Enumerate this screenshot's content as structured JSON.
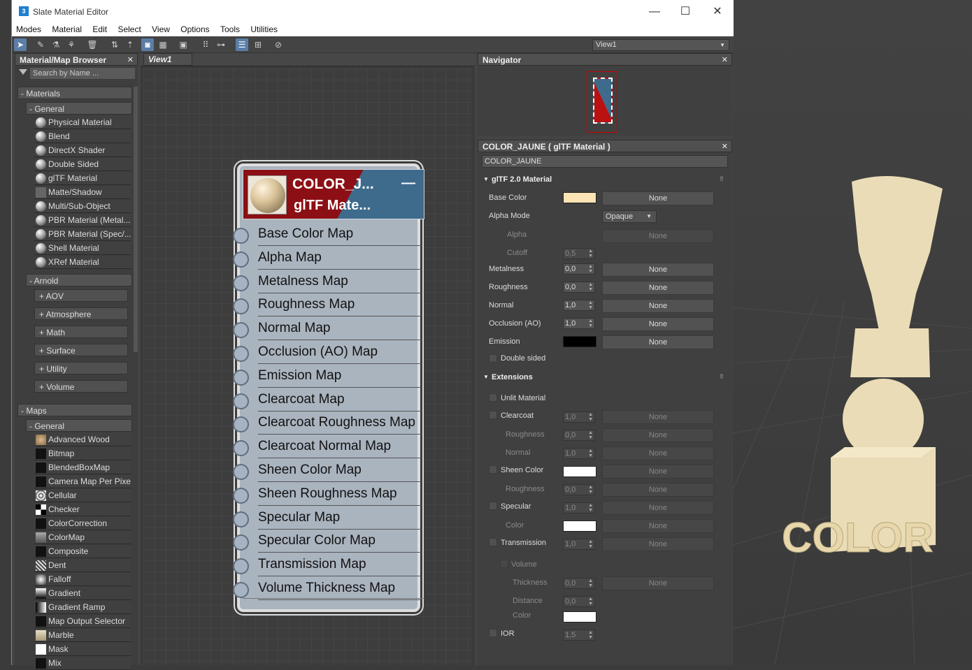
{
  "window": {
    "title": "Slate Material Editor",
    "app_icon": "3",
    "min": "—",
    "max": "☐",
    "close": "✕"
  },
  "menu": [
    "Modes",
    "Material",
    "Edit",
    "Select",
    "View",
    "Options",
    "Tools",
    "Utilities"
  ],
  "toolbar": {
    "view_select": "View1"
  },
  "browser": {
    "title": "Material/Map Browser",
    "search_placeholder": "Search by Name ...",
    "materials_label": "- Materials",
    "general_label": "- General",
    "materials": [
      "Physical Material",
      "Blend",
      "DirectX Shader",
      "Double Sided",
      "glTF Material",
      "Matte/Shadow",
      "Multi/Sub-Object",
      "PBR Material (Metal...",
      "PBR Material (Spec/...",
      "Shell Material",
      "XRef Material"
    ],
    "arnold_label": "- Arnold",
    "arnold": [
      "+ AOV",
      "+ Atmosphere",
      "+ Math",
      "+ Surface",
      "+ Utility",
      "+ Volume"
    ],
    "maps_label": "- Maps",
    "maps_general_label": "- General",
    "maps": [
      "Advanced Wood",
      "Bitmap",
      "BlendedBoxMap",
      "Camera Map Per Pixel",
      "Cellular",
      "Checker",
      "ColorCorrection",
      "ColorMap",
      "Composite",
      "Dent",
      "Falloff",
      "Gradient",
      "Gradient Ramp",
      "Map Output Selector",
      "Marble",
      "Mask",
      "Mix"
    ]
  },
  "view": {
    "tab": "View1"
  },
  "node": {
    "title": "COLOR_J...",
    "subtitle": "glTF  Mate...",
    "collapse": "—",
    "slots": [
      "Base Color Map",
      "Alpha Map",
      "Metalness Map",
      "Roughness Map",
      "Normal Map",
      "Occlusion (AO) Map",
      "Emission Map",
      "Clearcoat Map",
      "Clearcoat Roughness Map",
      "Clearcoat Normal Map",
      "Sheen Color Map",
      "Sheen Roughness Map",
      "Specular Map",
      "Specular Color Map",
      "Transmission Map",
      "Volume Thickness Map"
    ]
  },
  "navigator": {
    "title": "Navigator"
  },
  "props": {
    "title": "COLOR_JAUNE  ( glTF Material )",
    "name": "COLOR_JAUNE",
    "rollout1": "glTF 2.0 Material",
    "base_color_label": "Base Color",
    "base_color": "#fde4b4",
    "alpha_mode_label": "Alpha Mode",
    "alpha_mode": "Opaque",
    "alpha_label": "Alpha",
    "cutoff_label": "Cutoff",
    "cutoff": "0,5",
    "metalness_label": "Metalness",
    "metalness": "0,0",
    "roughness_label": "Roughness",
    "roughness": "0,0",
    "normal_label": "Normal",
    "normal": "1,0",
    "occlusion_label": "Occlusion (AO)",
    "occlusion": "1,0",
    "emission_label": "Emission",
    "double_sided_label": "Double sided",
    "none": "None",
    "rollout2": "Extensions",
    "unlit_label": "Unlit Material",
    "clearcoat_label": "Clearcoat",
    "clearcoat": "1,0",
    "cc_roughness_label": "Roughness",
    "cc_roughness": "0,0",
    "cc_normal_label": "Normal",
    "cc_normal": "1,0",
    "sheen_label": "Sheen Color",
    "sheen_roughness_label": "Roughness",
    "sheen_roughness": "0,0",
    "specular_label": "Specular",
    "specular": "1,0",
    "spec_color_label": "Color",
    "transmission_label": "Transmission",
    "transmission": "1,0",
    "volume_label": "Volume",
    "thickness_label": "Thickness",
    "thickness": "0,0",
    "distance_label": "Distance",
    "distance": "0,0",
    "vol_color_label": "Color",
    "ior_label": "IOR",
    "ior": "1,5"
  },
  "scene": {
    "text": "COLOR"
  }
}
